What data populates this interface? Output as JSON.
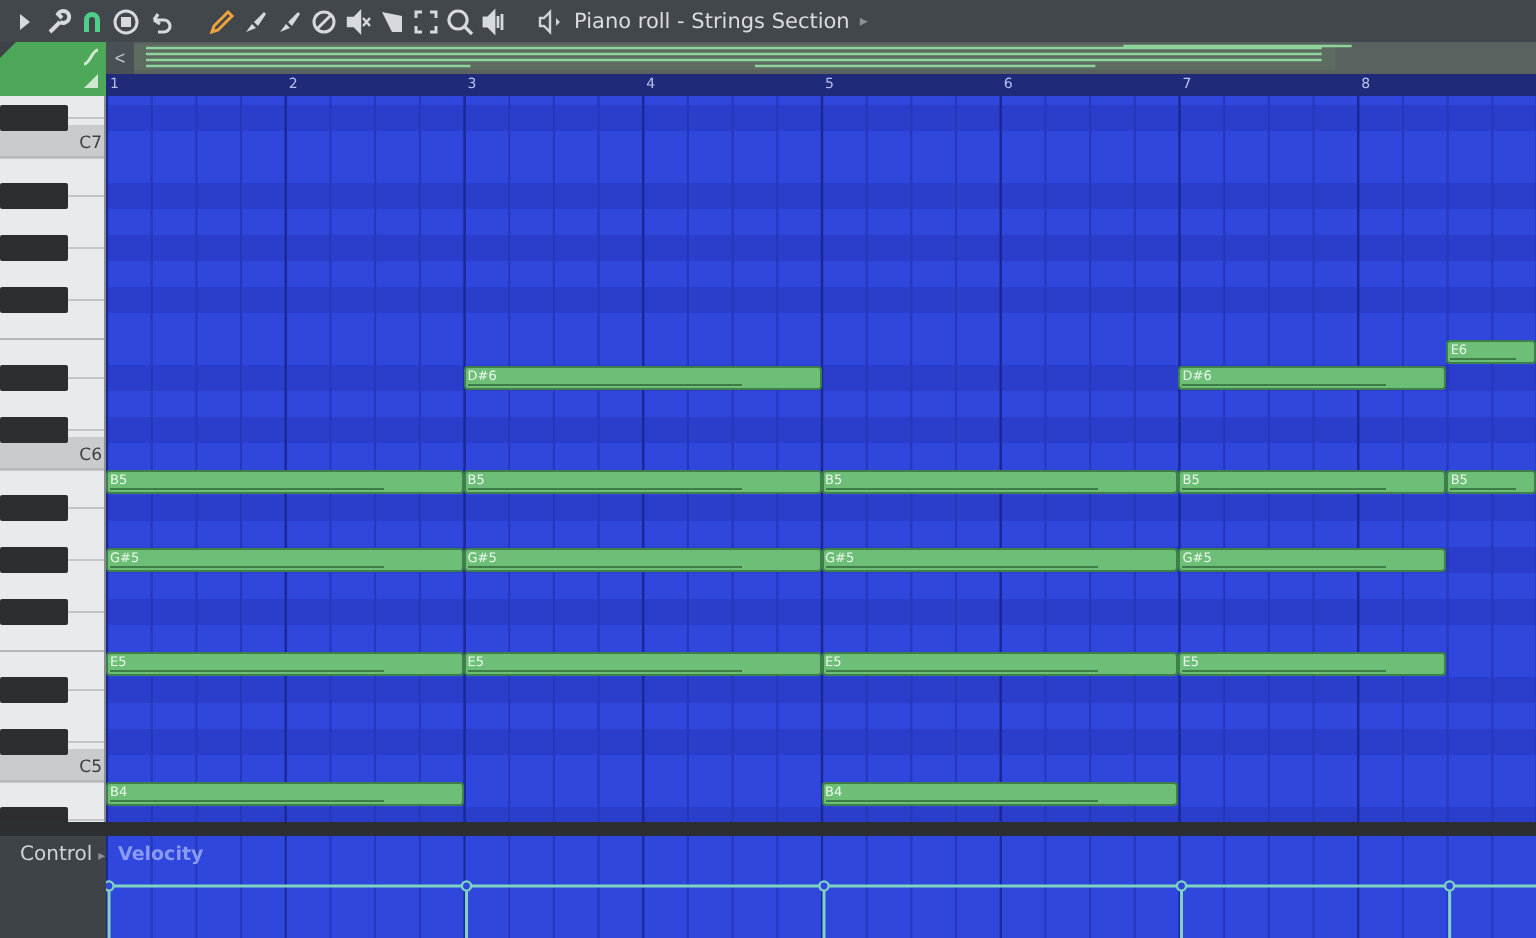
{
  "toolbar": {
    "tools": [
      {
        "kind": "play",
        "selected": false
      },
      {
        "kind": "wrench",
        "selected": false
      },
      {
        "kind": "magnet",
        "selected": true
      },
      {
        "kind": "record",
        "selected": false
      },
      {
        "kind": "undo",
        "selected": false
      },
      {
        "kind": "pencil",
        "selected": true
      },
      {
        "kind": "brush",
        "selected": false
      },
      {
        "kind": "brush",
        "selected": false
      },
      {
        "kind": "erase",
        "selected": false
      },
      {
        "kind": "mute",
        "selected": false
      },
      {
        "kind": "slice",
        "selected": false
      },
      {
        "kind": "select",
        "selected": false
      },
      {
        "kind": "zoom",
        "selected": false
      },
      {
        "kind": "preview",
        "selected": false
      }
    ],
    "title": "Piano roll - Strings Section",
    "title_arrow": "▸"
  },
  "overview": {
    "scroll_left": "<"
  },
  "ruler": {
    "bars": [
      "1",
      "2",
      "3",
      "4",
      "5",
      "6",
      "7",
      "8"
    ]
  },
  "keys": [
    {
      "kind": "white"
    },
    {
      "kind": "black"
    },
    {
      "kind": "white",
      "label": "C7"
    },
    {
      "kind": "white"
    },
    {
      "kind": "black"
    },
    {
      "kind": "white"
    },
    {
      "kind": "black"
    },
    {
      "kind": "white"
    },
    {
      "kind": "black"
    },
    {
      "kind": "white"
    },
    {
      "kind": "white",
      "notes": [
        {
          "kind": "rest"
        },
        {
          "kind": "rest"
        },
        {
          "kind": "rest"
        },
        {
          "kind": "rest"
        },
        {
          "kind": "note",
          "label": "E6"
        }
      ]
    },
    {
      "kind": "black",
      "notes": [
        {
          "kind": "rest"
        },
        {
          "kind": "note",
          "label": "D#6"
        },
        {
          "kind": "rest"
        },
        {
          "kind": "note",
          "label": "D#6"
        },
        {
          "kind": "rest"
        }
      ]
    },
    {
      "kind": "white"
    },
    {
      "kind": "black"
    },
    {
      "kind": "white",
      "label": "C6"
    },
    {
      "kind": "white",
      "notes": [
        {
          "kind": "note",
          "label": "B5"
        },
        {
          "kind": "note",
          "label": "B5"
        },
        {
          "kind": "note",
          "label": "B5"
        },
        {
          "kind": "note",
          "label": "B5"
        },
        {
          "kind": "note",
          "label": "B5"
        }
      ]
    },
    {
      "kind": "black"
    },
    {
      "kind": "white"
    },
    {
      "kind": "black",
      "notes": [
        {
          "kind": "note",
          "label": "G#5"
        },
        {
          "kind": "note",
          "label": "G#5"
        },
        {
          "kind": "note",
          "label": "G#5"
        },
        {
          "kind": "note",
          "label": "G#5"
        },
        {
          "kind": "rest"
        }
      ]
    },
    {
      "kind": "white"
    },
    {
      "kind": "black"
    },
    {
      "kind": "white"
    },
    {
      "kind": "white",
      "notes": [
        {
          "kind": "note",
          "label": "E5"
        },
        {
          "kind": "note",
          "label": "E5"
        },
        {
          "kind": "note",
          "label": "E5"
        },
        {
          "kind": "note",
          "label": "E5"
        },
        {
          "kind": "rest"
        }
      ]
    },
    {
      "kind": "black"
    },
    {
      "kind": "white"
    },
    {
      "kind": "black"
    },
    {
      "kind": "white",
      "label": "C5"
    },
    {
      "kind": "white",
      "notes": [
        {
          "kind": "note",
          "label": "B4"
        },
        {
          "kind": "rest"
        },
        {
          "kind": "note",
          "label": "B4"
        },
        {
          "kind": "rest"
        },
        {
          "kind": "rest"
        }
      ]
    },
    {
      "kind": "black"
    }
  ],
  "control": {
    "label": "Control",
    "arrow": "▸",
    "parameter": "Velocity"
  }
}
